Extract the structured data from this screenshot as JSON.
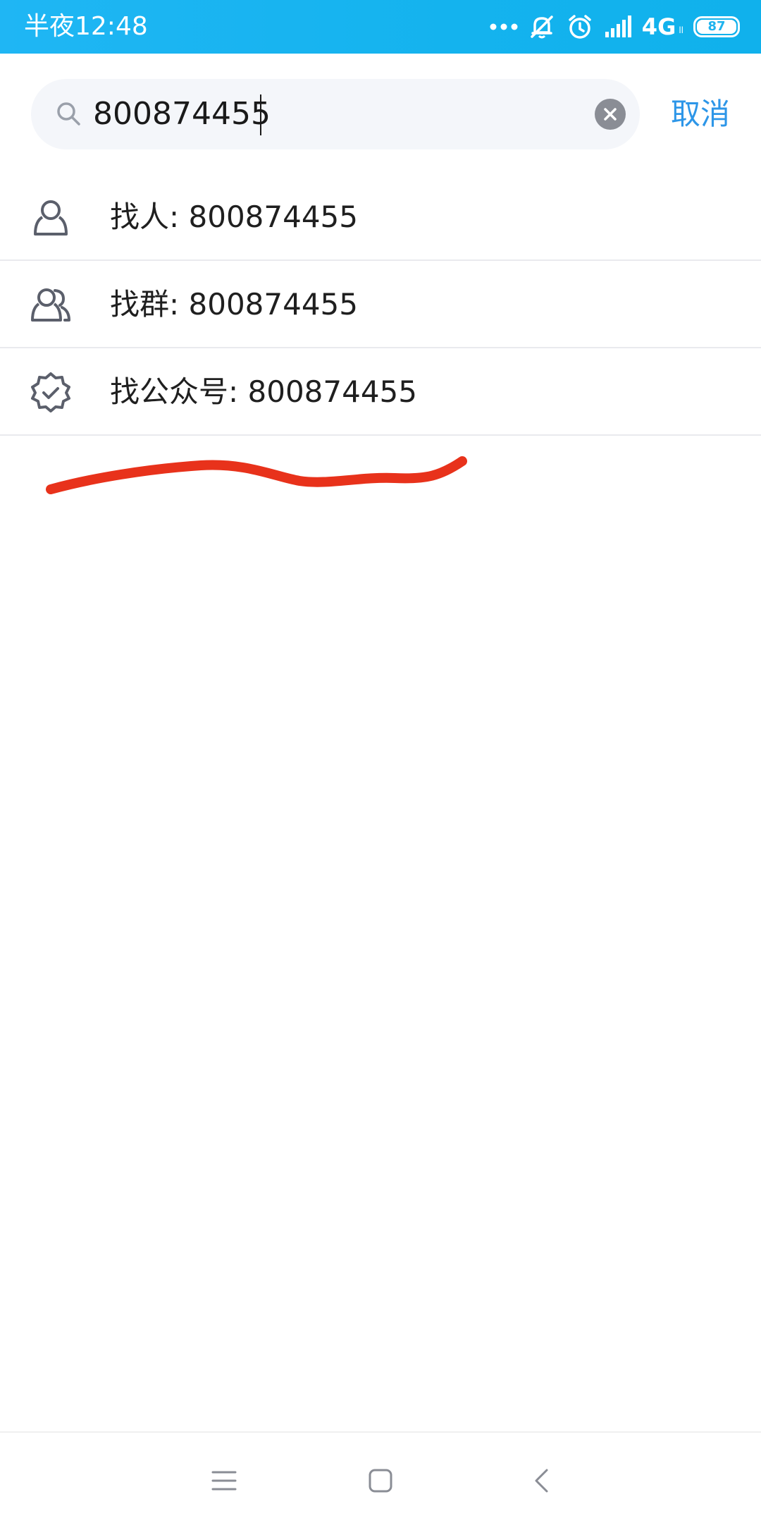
{
  "status_bar": {
    "time": "半夜12:48",
    "network": "4G",
    "network_sub": "ll",
    "battery": "87",
    "icons": [
      "more-dots-icon",
      "bell-off-icon",
      "alarm-icon",
      "signal-icon",
      "battery-icon"
    ]
  },
  "search": {
    "value": "800874455",
    "cancel_label": "取消",
    "icons": [
      "search-icon",
      "clear-icon"
    ]
  },
  "results": [
    {
      "label": "找人: 800874455",
      "icon": "person-icon"
    },
    {
      "label": "找群: 800874455",
      "icon": "group-icon"
    },
    {
      "label": "找公众号: 800874455",
      "icon": "verified-badge-icon"
    }
  ],
  "nav_bar": {
    "icons": [
      "menu-icon",
      "home-icon",
      "back-icon"
    ]
  },
  "colors": {
    "status_bar": "#1fb3ee",
    "accent": "#2d96e8",
    "annotation": "#e8321b",
    "icon_stroke": "#5b5f6b"
  }
}
